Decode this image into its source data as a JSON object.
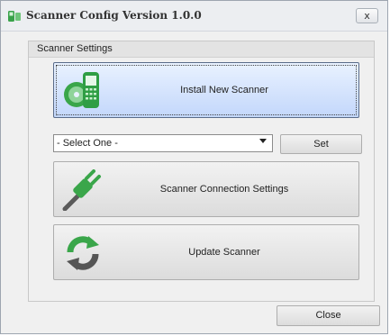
{
  "window": {
    "title": "Scanner Config Version 1.0.0",
    "close_glyph": "x",
    "app_icon": "scanner-device-icon"
  },
  "group": {
    "label": "Scanner Settings"
  },
  "buttons": {
    "install": {
      "label": "Install New Scanner",
      "icon": "handheld-scanner-disc-icon"
    },
    "connection": {
      "label": "Scanner Connection Settings",
      "icon": "plug-icon"
    },
    "update": {
      "label": "Update Scanner",
      "icon": "refresh-arrows-icon"
    },
    "set": {
      "label": "Set"
    },
    "close": {
      "label": "Close"
    }
  },
  "dropdown": {
    "selected": "- Select One -"
  },
  "colors": {
    "accent_green": "#3aa64a",
    "primary_button_top": "#e9f2ff",
    "primary_button_bottom": "#c3d7fb"
  }
}
